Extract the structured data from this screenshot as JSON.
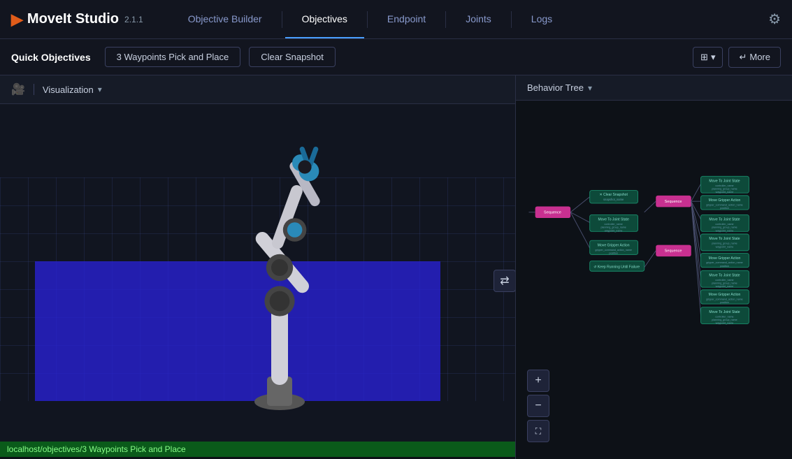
{
  "app": {
    "logo_icon": "▶",
    "logo_name": "MoveIt Studio",
    "logo_version": "2.1.1"
  },
  "nav": {
    "items": [
      {
        "label": "Objective Builder",
        "active": false
      },
      {
        "label": "Objectives",
        "active": true
      },
      {
        "label": "Endpoint",
        "active": false
      },
      {
        "label": "Joints",
        "active": false
      },
      {
        "label": "Logs",
        "active": false
      }
    ]
  },
  "toolbar": {
    "quick_objectives_label": "Quick Objectives",
    "btn_waypoints": "3 Waypoints Pick and Place",
    "btn_clear": "Clear Snapshot",
    "more_label": "More",
    "layout_icon": "⊞"
  },
  "viz_panel": {
    "header_title": "Visualization",
    "camera_icon": "📷",
    "swap_icon": "⇄"
  },
  "bt_panel": {
    "header_title": "Behavior Tree"
  },
  "status_bar": {
    "text": "localhost/objectives/3 Waypoints Pick and Place"
  },
  "zoom_controls": {
    "zoom_in": "+",
    "zoom_out": "−",
    "fit": "⛶"
  }
}
